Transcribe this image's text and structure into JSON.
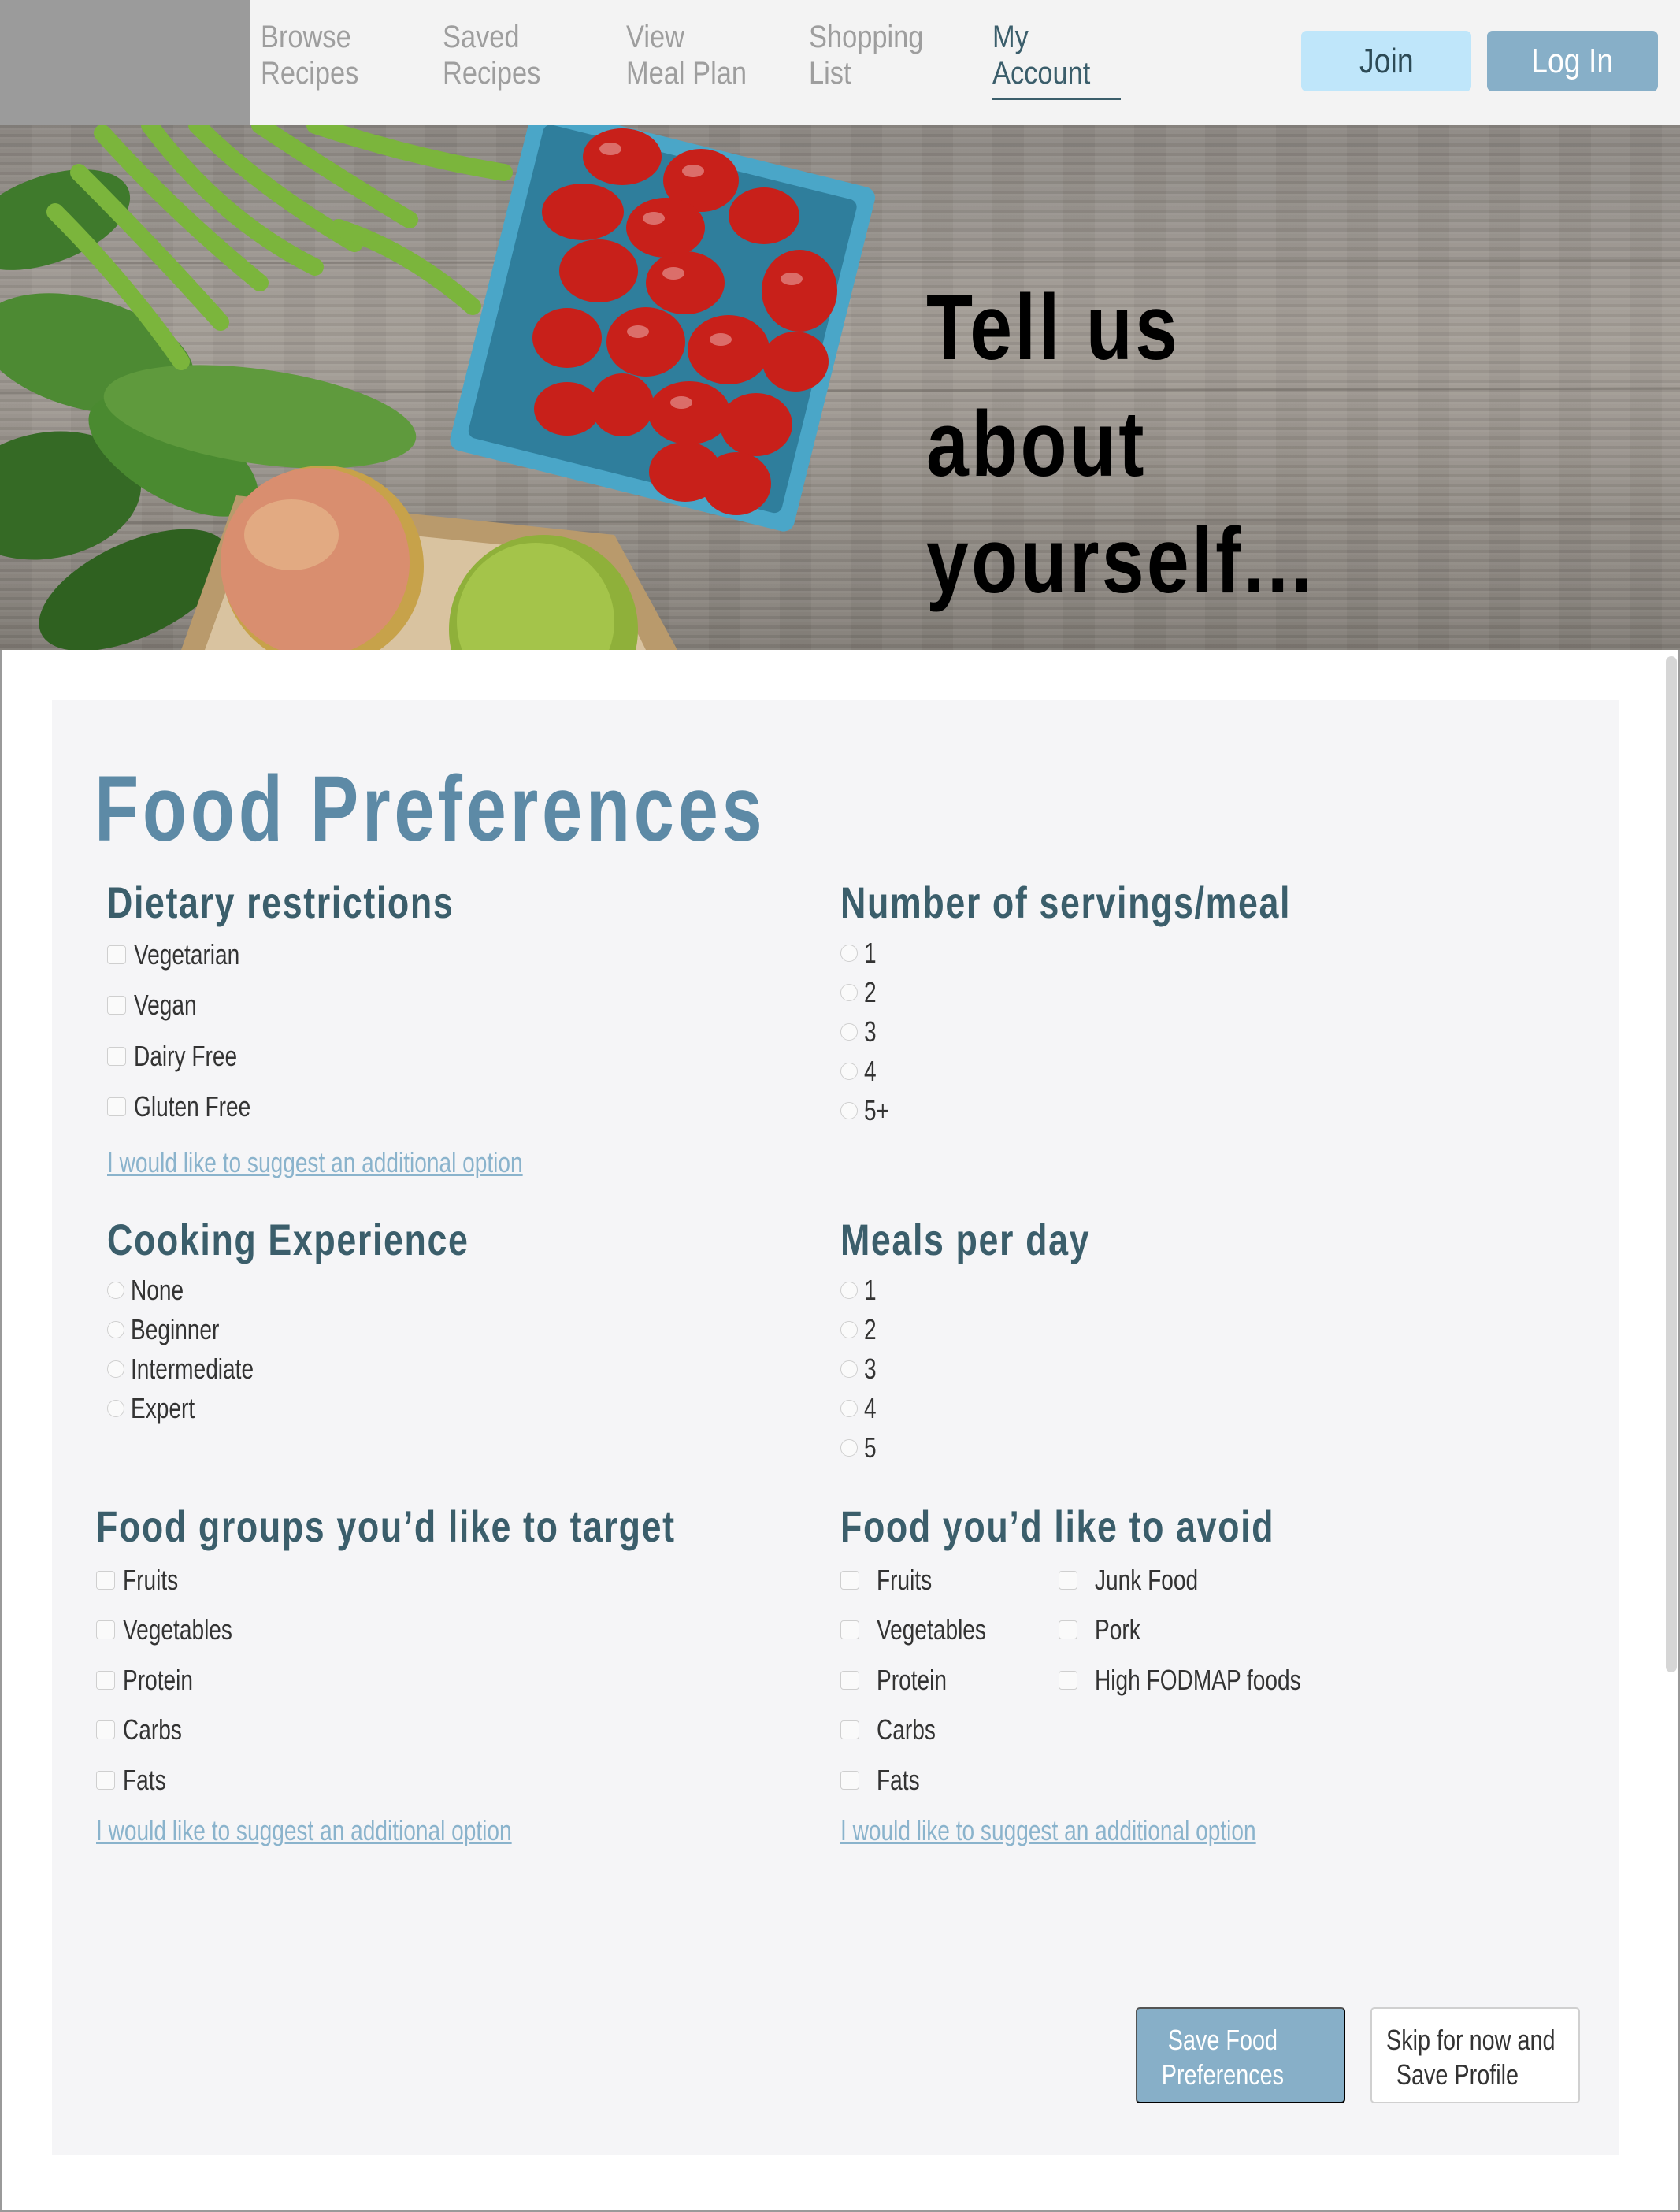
{
  "nav": {
    "links": [
      {
        "line1": "Browse",
        "line2": "Recipes"
      },
      {
        "line1": "Saved",
        "line2": "Recipes"
      },
      {
        "line1": "View",
        "line2": "Meal Plan"
      },
      {
        "line1": "Shopping",
        "line2": "List"
      },
      {
        "line1": "My",
        "line2": "Account"
      }
    ],
    "active_link": "My Account",
    "join_label": "Join",
    "login_label": "Log In"
  },
  "hero": {
    "title_line1": "Tell us about",
    "title_line2": "yourself..."
  },
  "main": {
    "title": "Food Preferences",
    "dietary": {
      "title": "Dietary restrictions",
      "options": [
        "Vegetarian",
        "Vegan",
        "Dairy Free",
        "Gluten Free"
      ],
      "suggest": "I would like to suggest an additional option"
    },
    "servings": {
      "title": "Number of servings/meal",
      "options": [
        "1",
        "2",
        "3",
        "4",
        "5+"
      ]
    },
    "experience": {
      "title": "Cooking Experience",
      "options": [
        "None",
        "Beginner",
        "Intermediate",
        "Expert"
      ]
    },
    "meals": {
      "title": "Meals per day",
      "options": [
        "1",
        "2",
        "3",
        "4",
        "5"
      ]
    },
    "target": {
      "title": "Food groups you’d like to target",
      "options": [
        "Fruits",
        "Vegetables",
        "Protein",
        "Carbs",
        "Fats"
      ],
      "suggest": "I would like to suggest an additional option"
    },
    "avoid": {
      "title": "Food you’d like to avoid",
      "options_col1": [
        "Fruits",
        "Vegetables",
        "Protein",
        "Carbs",
        "Fats"
      ],
      "options_col2": [
        "Junk Food",
        "Pork",
        "High FODMAP foods"
      ],
      "suggest": "I would like to suggest an additional option"
    },
    "save_button": {
      "line1": "Save Food",
      "line2": "Preferences"
    },
    "skip_button": {
      "line1": "Skip for now and",
      "line2": "Save Profile"
    }
  },
  "colors": {
    "accent": "#5d8aa6",
    "heading": "#3b5e6b",
    "link": "#8ab3cc",
    "join_bg": "#bfe6fa",
    "login_bg": "#87afc8",
    "card_bg": "#f5f5f7"
  }
}
